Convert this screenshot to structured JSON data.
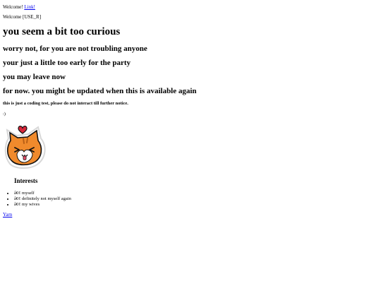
{
  "header": {
    "welcome_prefix": "Welcome!",
    "link_label": "Link!",
    "welcome_user": "Welcome [USE_R]"
  },
  "main": {
    "headline": "you seem a bit too curious",
    "lines": [
      "worry not, for you are not troubling anyone",
      "your just a little too early for the party",
      "you may leave now",
      "for now. you might be updated when this is available again"
    ],
    "notice": "this is just a coding test, please do not interact till further notice.",
    "smiley": ":)"
  },
  "image": {
    "icon": "cat-with-heart-sticker"
  },
  "interests": {
    "title": "Interests",
    "items": [
      "â€¢ myself",
      "â€¢ definitely not myself again",
      "â€¢ my wives"
    ]
  },
  "footer": {
    "yarn_link": "Yarn"
  },
  "colors": {
    "link": "#0000ee",
    "cat_orange": "#f08a2c",
    "heart": "#d6273a"
  }
}
